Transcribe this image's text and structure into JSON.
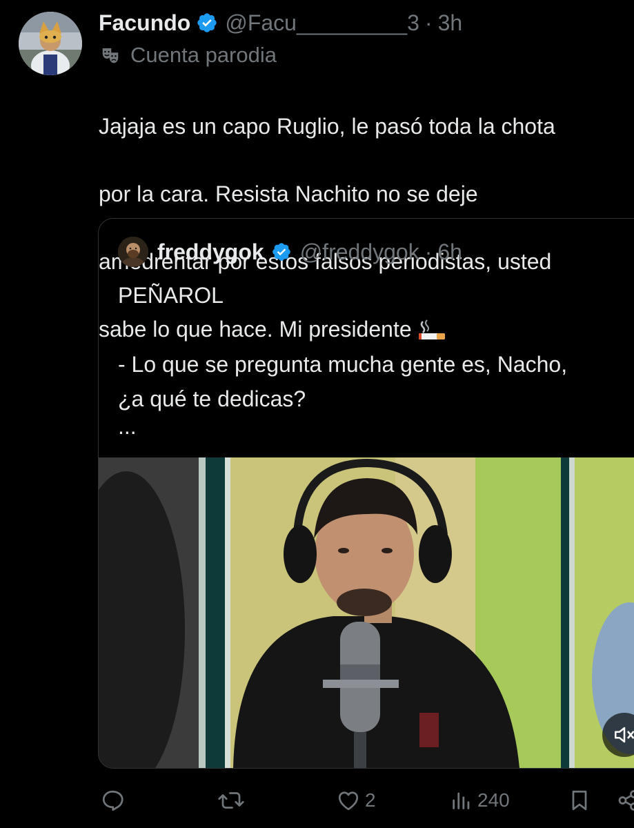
{
  "author": {
    "display_name": "Facundo",
    "handle": "@Facu_________3",
    "separator": "·",
    "time": "3h",
    "label": "Cuenta parodia"
  },
  "tweet": {
    "lines": [
      "Jajaja es un capo Ruglio, le pasó toda la chota",
      "por la cara. Resista Nachito no se deje",
      "amedrentar por estos falsos periodistas, usted",
      "sabe lo que hace. Mi presidente"
    ],
    "emoji": "cigarette"
  },
  "quoted": {
    "display_name": "freddygok",
    "handle": "@freddygok",
    "separator": "·",
    "time": "6h",
    "lines": [
      "PEÑAROL",
      "",
      "- Lo que se pregunta mucha gente es, Nacho,",
      "¿a qué te dedicas?",
      "..."
    ]
  },
  "actions": {
    "reply_icon": "reply-icon",
    "retweet_icon": "retweet-icon",
    "like_icon": "heart-icon",
    "like_count": "2",
    "views_icon": "views-icon",
    "views_count": "240",
    "bookmark_icon": "bookmark-icon",
    "share_icon": "share-icon"
  },
  "colors": {
    "background": "#000000",
    "text": "#e7e9ea",
    "muted": "#71767b",
    "verified": "#1d9bf0",
    "border": "#2f3336"
  }
}
